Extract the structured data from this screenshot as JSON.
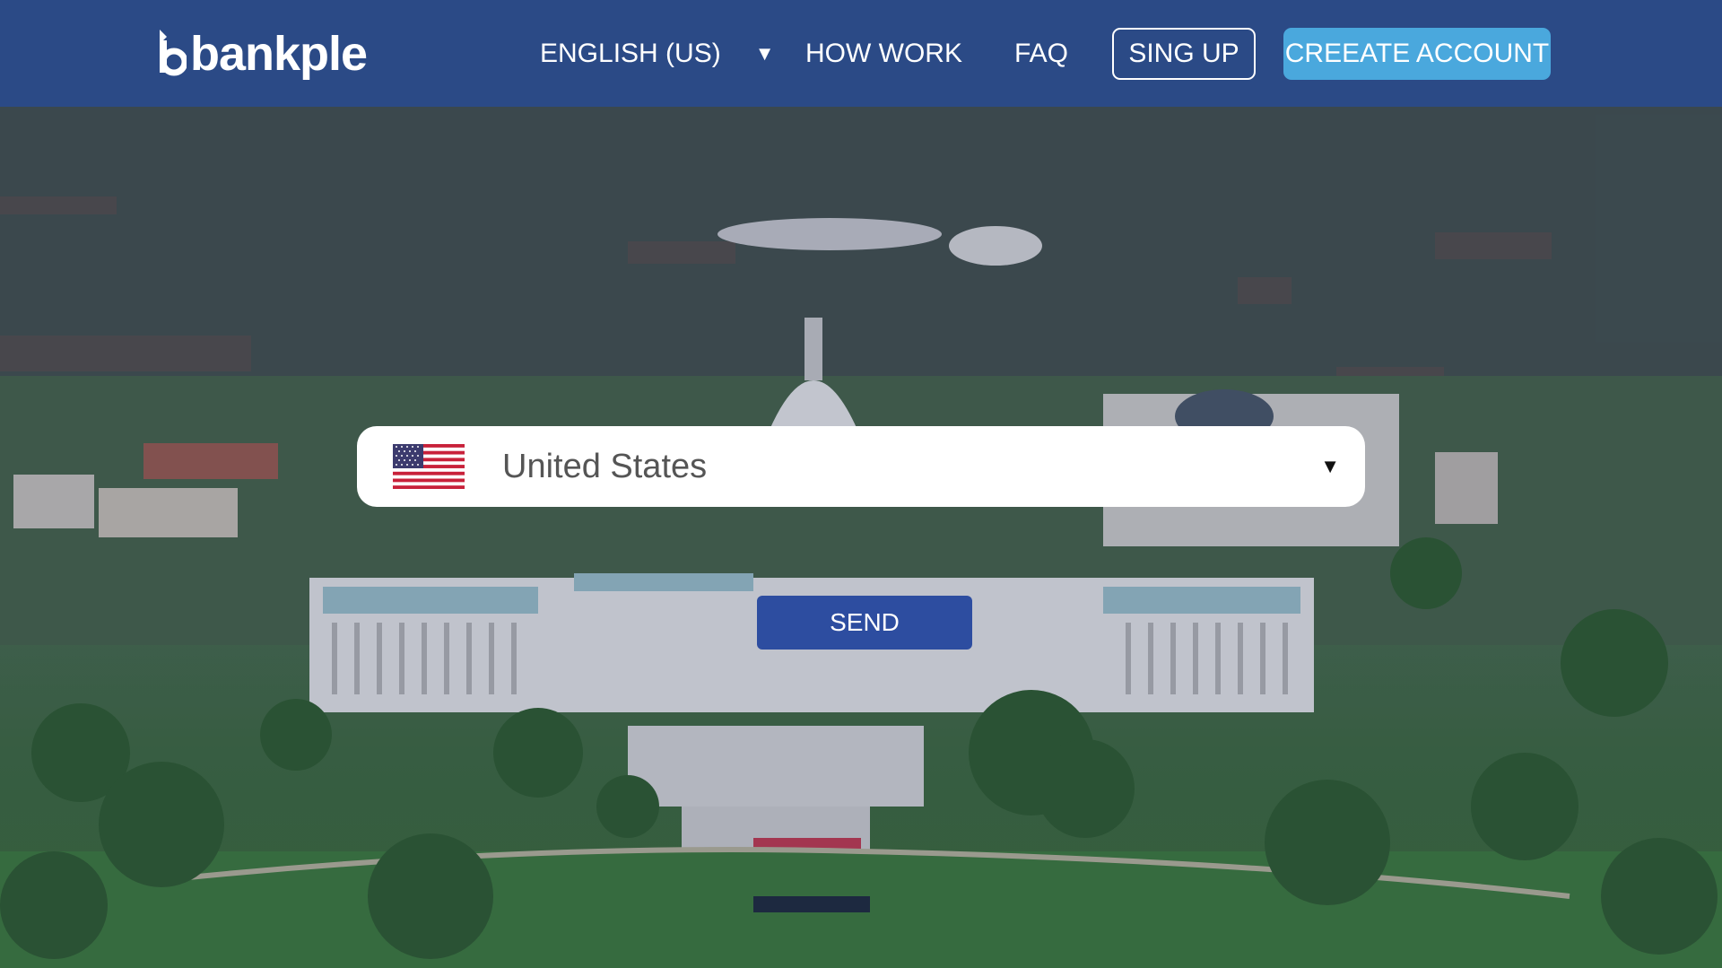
{
  "header": {
    "logo_text": "bankple",
    "language_label": "ENGLISH (US)",
    "nav": {
      "how_work": "HOW WORK",
      "faq": "FAQ"
    },
    "sign_up_label": "SING UP",
    "create_account_label": "CREEATE ACCOUNT"
  },
  "selector": {
    "country": "United States",
    "flag_icon": "us-flag-icon"
  },
  "send_label": "SEND",
  "colors": {
    "header_bg": "#2b4a86",
    "create_account_bg": "#4aa8dd",
    "send_bg": "#2d4da0",
    "selector_bg": "#ffffff"
  }
}
